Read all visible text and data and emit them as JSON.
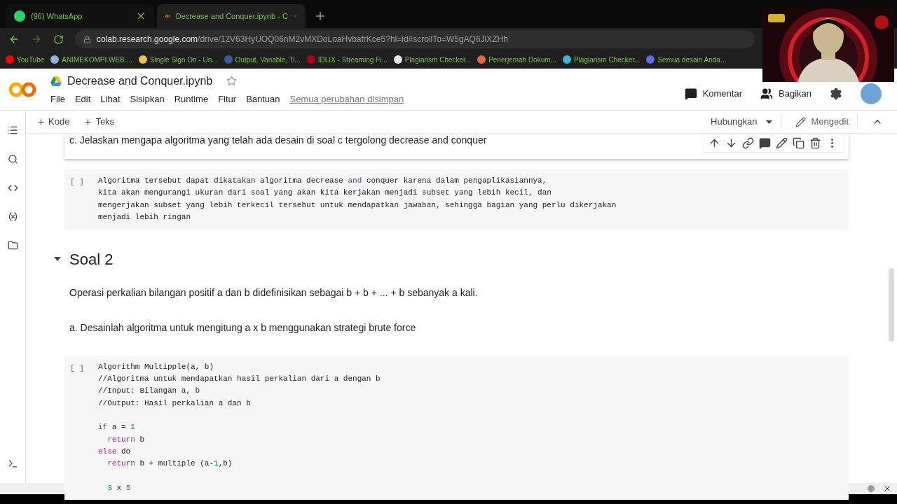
{
  "browser": {
    "tabs": [
      {
        "title": "(96) WhatsApp",
        "kind": "whatsapp",
        "selected": false
      },
      {
        "title": "Decrease and Conquer.ipynb - C",
        "kind": "colab",
        "selected": true
      }
    ],
    "url": {
      "host": "colab.research.google.com",
      "path": "/drive/12V63HyUOQ06nM2vMXDoLoaHvbafrKce5?hl=id#scrollTo=W5gAQ6JlXZHh"
    },
    "bookmarks": [
      {
        "label": "YouTube",
        "color": "#ff0000"
      },
      {
        "label": "ANIMEKOMPI.WEB....",
        "color": "#8fb3d9"
      },
      {
        "label": "Single Sign On - Un...",
        "color": "#e8c24a"
      },
      {
        "label": "Output, Variable, Ti...",
        "color": "#3a5a9a"
      },
      {
        "label": "IDLIX - Streaming Fi...",
        "color": "#b00020"
      },
      {
        "label": "Plagiarism Checker...",
        "color": "#e6e6e6"
      },
      {
        "label": "Penerjemah Dokum...",
        "color": "#e2683c"
      },
      {
        "label": "Plagiarism Checker...",
        "color": "#3fb6d8"
      },
      {
        "label": "Semua desain Anda...",
        "color": "#5b6ee1"
      }
    ]
  },
  "colab": {
    "title": "Decrease and Conquer.ipynb",
    "menu": [
      "File",
      "Edit",
      "Lihat",
      "Sisipkan",
      "Runtime",
      "Fitur",
      "Bantuan"
    ],
    "save_status": "Semua perubahan disimpan",
    "header_actions": [
      {
        "label": "Komentar",
        "kind": "comment"
      },
      {
        "label": "Bagikan",
        "kind": "share"
      }
    ],
    "toolbar": {
      "add": [
        "Kode",
        "Teks"
      ],
      "connect": "Hubungkan",
      "mode": "Mengedit"
    }
  },
  "cells": [
    {
      "kind": "text",
      "text": "c. Jelaskan mengapa algoritma yang telah ada desain di soal c tergolong decrease and conquer",
      "selected": true
    },
    {
      "kind": "code",
      "run_label": "[ ]",
      "blocks": [
        [
          [
            {
              "text": "Algoritma tersebut dapat dikatakan algoritma decrease ",
              "kind": "plain"
            },
            {
              "text": "and",
              "kind": "operator"
            },
            {
              "text": " conquer karena dalam pengaplikasiannya,",
              "kind": "plain"
            }
          ],
          [
            {
              "text": "kita akan mengurangi ukuran dari soal yang akan kita kerjakan menjadi subset yang lebih kecil, dan",
              "kind": "plain"
            }
          ],
          [
            {
              "text": "mengerjakan subset yang lebih terkecil tersebut untuk mendapatkan jawaban, sehingga bagian yang perlu dikerjakan",
              "kind": "plain"
            }
          ],
          [
            {
              "text": "menjadi lebih ringan",
              "kind": "plain"
            }
          ]
        ]
      ]
    },
    {
      "kind": "heading",
      "text": "Soal 2",
      "expanded": true
    },
    {
      "kind": "text",
      "text": "Operasi perkalian bilangan positif a dan b didefinisikan sebagai b + b + ... + b sebanyak a kali.",
      "selected": false
    },
    {
      "kind": "text",
      "text": "a. Desainlah algoritma untuk mengitung a x b menggunakan strategi brute force",
      "selected": false
    },
    {
      "kind": "code",
      "run_label": "[ ]",
      "blocks": [
        [
          [
            {
              "text": "Algorithm Multipple(a, b)",
              "kind": "plain"
            }
          ],
          [
            {
              "text": "//Algoritma untuk mendapatkan hasil perkalian dari a dengan b",
              "kind": "plain"
            }
          ],
          [
            {
              "text": "//Input: Bilangan a, b",
              "kind": "plain"
            }
          ],
          [
            {
              "text": "//Output: Hasil perkalian a dan b",
              "kind": "plain"
            }
          ]
        ],
        [
          [
            {
              "text": "if",
              "kind": "keyword"
            },
            {
              "text": " a = ",
              "kind": "plain"
            },
            {
              "text": "1",
              "kind": "number"
            }
          ],
          [
            {
              "text": "  return",
              "kind": "keyword"
            },
            {
              "text": " b",
              "kind": "plain"
            }
          ],
          [
            {
              "text": "else",
              "kind": "keyword"
            },
            {
              "text": " do",
              "kind": "plain"
            }
          ],
          [
            {
              "text": "  return",
              "kind": "keyword"
            },
            {
              "text": " b + multiple (a-",
              "kind": "plain"
            },
            {
              "text": "1",
              "kind": "number"
            },
            {
              "text": ",b)",
              "kind": "plain"
            }
          ]
        ],
        [
          [
            {
              "text": "  3",
              "kind": "number"
            },
            {
              "text": " x ",
              "kind": "plain"
            },
            {
              "text": "5",
              "kind": "number"
            }
          ]
        ]
      ]
    }
  ]
}
